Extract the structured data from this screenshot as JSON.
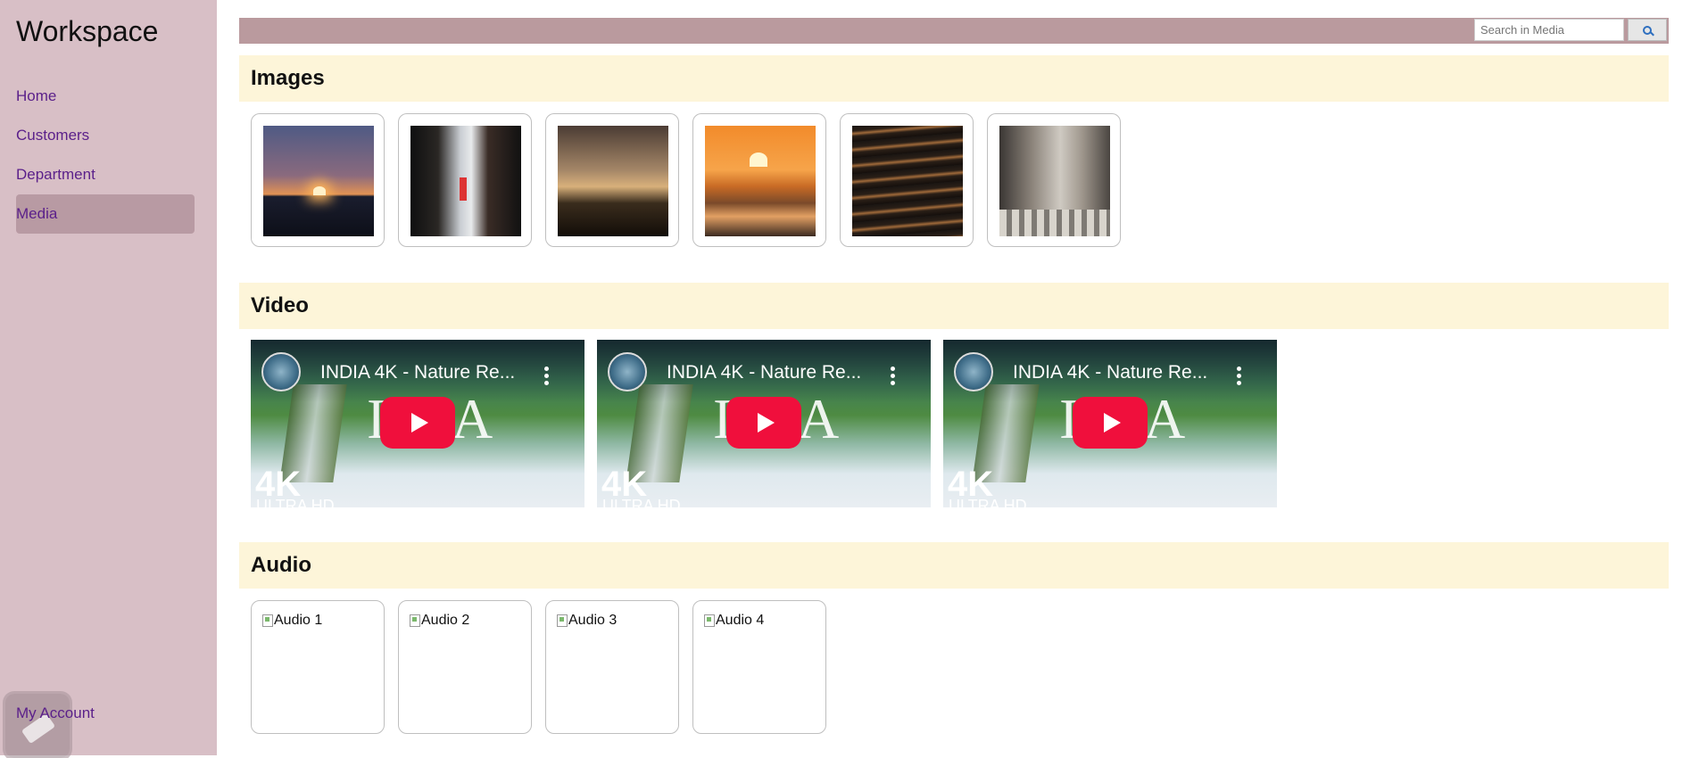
{
  "sidebar": {
    "brand": "Workspace",
    "items": [
      {
        "label": "Home"
      },
      {
        "label": "Customers"
      },
      {
        "label": "Department"
      },
      {
        "label": "Media"
      }
    ],
    "active_item": "Media",
    "account_label": "My Account"
  },
  "topbar": {
    "search_placeholder": "Search in Media"
  },
  "sections": {
    "images_title": "Images",
    "video_title": "Video",
    "audio_title": "Audio"
  },
  "images": [
    {
      "alt": "sunset over ocean"
    },
    {
      "alt": "city alley"
    },
    {
      "alt": "sunset over lake"
    },
    {
      "alt": "sun setting over sea"
    },
    {
      "alt": "dark water waves"
    },
    {
      "alt": "city street crossing"
    }
  ],
  "videos": [
    {
      "title": "INDIA 4K - Nature Re...",
      "badge": "4K",
      "subtitle": "ULTRA HD"
    },
    {
      "title": "INDIA 4K - Nature Re...",
      "badge": "4K",
      "subtitle": "ULTRA HD"
    },
    {
      "title": "INDIA 4K - Nature Re...",
      "badge": "4K",
      "subtitle": "ULTRA HD"
    }
  ],
  "audio": [
    {
      "label": "Audio 1"
    },
    {
      "label": "Audio 2"
    },
    {
      "label": "Audio 3"
    },
    {
      "label": "Audio 4"
    }
  ],
  "colors": {
    "sidebar_bg": "#d8bfc6",
    "active_nav_bg": "#b89aa3",
    "nav_link": "#5a1f8a",
    "topbar_bg": "#ba9a9e",
    "section_header_bg": "#fdf5d9",
    "play_button": "#f00f3c"
  },
  "icons": {
    "search_button": "magnifier-icon",
    "account": "pencil-icon",
    "video_menu": "kebab-menu-icon",
    "video_play": "play-icon"
  }
}
